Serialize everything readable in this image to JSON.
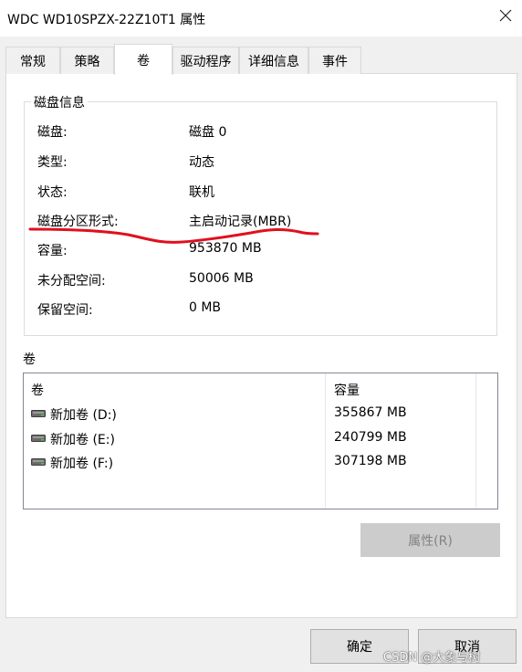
{
  "window": {
    "title": "WDC WD10SPZX-22Z10T1 属性",
    "close_glyph": "✕"
  },
  "tabs": [
    {
      "label": "常规",
      "active": false
    },
    {
      "label": "策略",
      "active": false
    },
    {
      "label": "卷",
      "active": true
    },
    {
      "label": "驱动程序",
      "active": false
    },
    {
      "label": "详细信息",
      "active": false
    },
    {
      "label": "事件",
      "active": false
    }
  ],
  "disk_info": {
    "group_title": "磁盘信息",
    "rows": [
      {
        "label": "磁盘:",
        "value": "磁盘 0"
      },
      {
        "label": "类型:",
        "value": "动态"
      },
      {
        "label": "状态:",
        "value": "联机"
      },
      {
        "label": "磁盘分区形式:",
        "value": "主启动记录(MBR)"
      },
      {
        "label": "容量:",
        "value": "953870 MB"
      },
      {
        "label": "未分配空间:",
        "value": "50006 MB"
      },
      {
        "label": "保留空间:",
        "value": "0 MB"
      }
    ],
    "annotation_color": "#e0101e"
  },
  "volumes": {
    "heading": "卷",
    "columns": [
      "卷",
      "容量"
    ],
    "rows": [
      {
        "name": "新加卷 (D:)",
        "capacity": "355867 MB",
        "icon": "drive-icon"
      },
      {
        "name": "新加卷 (E:)",
        "capacity": "240799 MB",
        "icon": "drive-icon"
      },
      {
        "name": "新加卷 (F:)",
        "capacity": "307198 MB",
        "icon": "drive-icon"
      }
    ]
  },
  "buttons": {
    "properties": "属性(R)",
    "ok": "确定",
    "cancel": "取消"
  },
  "watermark": "CSDN @大象与树"
}
